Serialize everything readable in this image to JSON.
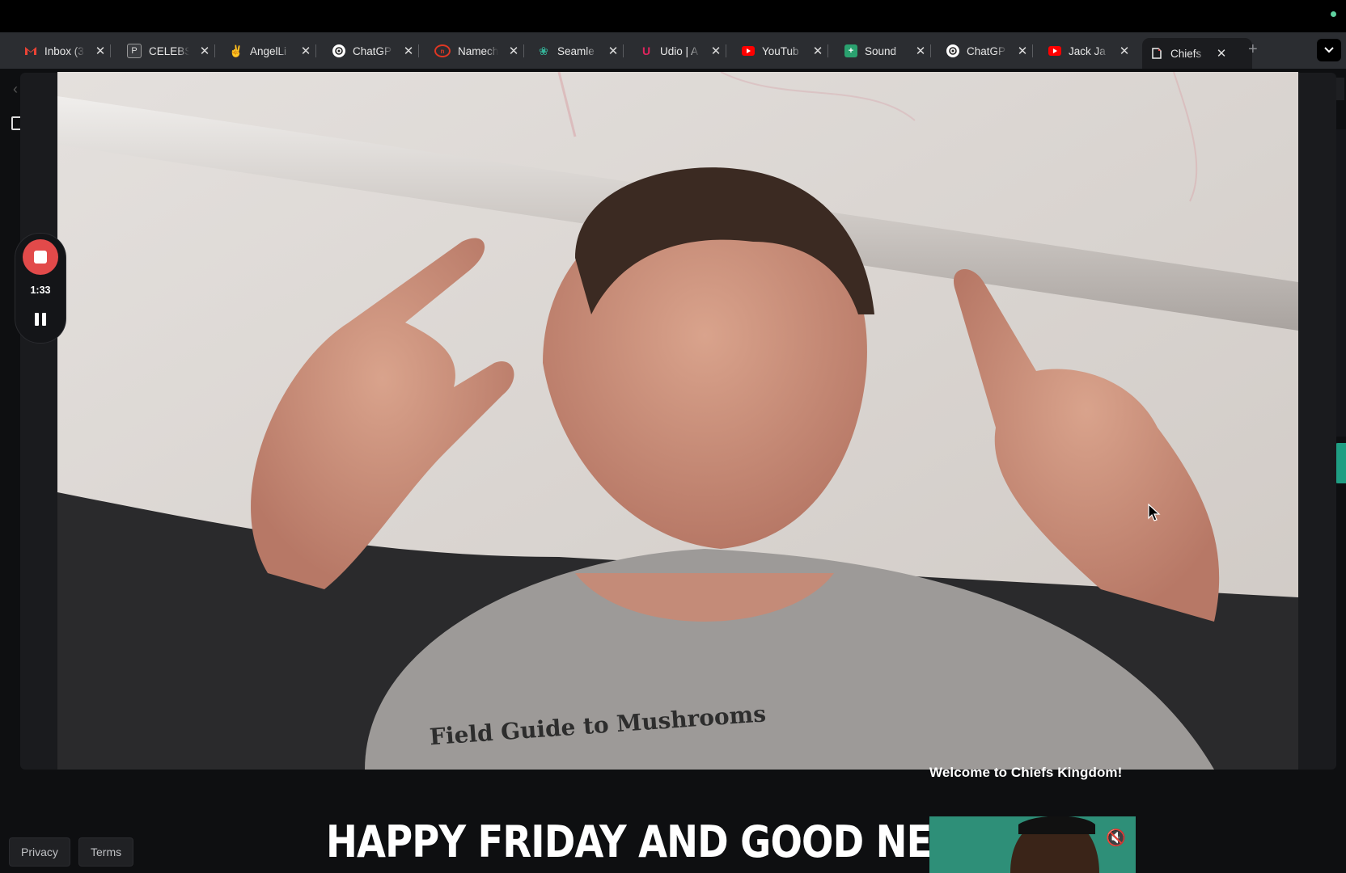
{
  "browser": {
    "tabs": [
      {
        "label": "Inbox (3",
        "icon": "gmail-icon"
      },
      {
        "label": "CELEBS",
        "icon": "celebs-icon"
      },
      {
        "label": "AngelLi",
        "icon": "angellist-icon"
      },
      {
        "label": "ChatGP",
        "icon": "chatgpt-icon"
      },
      {
        "label": "Namech",
        "icon": "namecheap-icon"
      },
      {
        "label": "Seamle",
        "icon": "seamless-icon"
      },
      {
        "label": "Udio | A",
        "icon": "udio-icon"
      },
      {
        "label": "YouTub",
        "icon": "youtube-icon"
      },
      {
        "label": "Sound",
        "icon": "soundtrap-icon"
      },
      {
        "label": "ChatGP",
        "icon": "chatgpt-icon"
      },
      {
        "label": "Jack Ja",
        "icon": "youtube-icon"
      },
      {
        "label": "Chiefs",
        "icon": "document-icon",
        "active": true
      }
    ],
    "new_tab_label": "+",
    "dropdown_label": "⌄"
  },
  "recorder": {
    "time": "1:33"
  },
  "page": {
    "welcome_text": "Welcome to Chiefs Kingdom!",
    "banner_text": "HAPPY FRIDAY AND GOOD NEW YEARS",
    "footer": {
      "privacy": "Privacy",
      "terms": "Terms"
    }
  },
  "video": {
    "shirt_text": "Field Guide to Mushrooms"
  },
  "colors": {
    "record_red": "#e24a4a",
    "accent_green": "#1f9e83",
    "tab_bg": "#2b2d31",
    "active_tab_bg": "#1b1c1f"
  }
}
